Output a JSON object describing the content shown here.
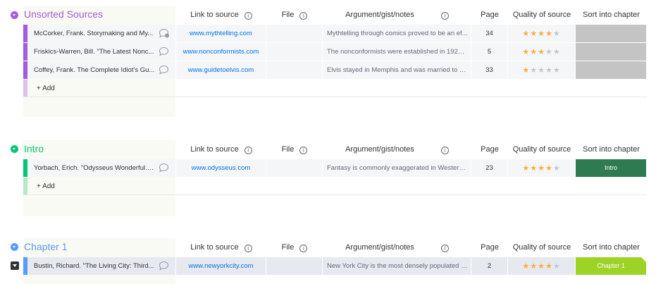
{
  "columns": {
    "link": "Link to source",
    "file": "File",
    "notes": "Argument/gist/notes",
    "page": "Page",
    "quality": "Quality of source",
    "sort": "Sort into chapter"
  },
  "colors": {
    "unsorted": "#a25ddc",
    "intro": "#00c875",
    "chapter1": "#579bfc",
    "intro_label": "#2f7b51",
    "chapter1_label": "#9cd326",
    "empty_label": "#c4c4c4",
    "star_on": "#fdab3d",
    "star_off": "#c5c7d0"
  },
  "groups": [
    {
      "title": "Unsorted Sources",
      "add_label": "+ Add",
      "rows": [
        {
          "name": "McCorker, Frank. Storymaking and My...",
          "link": "www.mythtelling.com",
          "notes": "Mythtelling through comics proved to be an ef...",
          "page": "34",
          "rating": 4,
          "chapter": ""
        },
        {
          "name": "Friskics-Warren, Bill. \"The Latest Nonc...",
          "link": "www.nonconformists.com",
          "notes": "The nonconformists were established in 1923 ...",
          "page": "5",
          "rating": 3,
          "chapter": ""
        },
        {
          "name": "Coffey, Frank. The Complete Idiot's Gu...",
          "link": "www.guidetoelvis.com",
          "notes": "Elvis stayed in Memphis and was married to P...",
          "page": "33",
          "rating": 1,
          "chapter": ""
        }
      ]
    },
    {
      "title": "Intro",
      "add_label": "+ Add",
      "rows": [
        {
          "name": "Yorbach, Erich. \"Odysseus Wonderful.\"...",
          "link": "www.odysseus.com",
          "notes": "Fantasy is commonly exaggerated in Western ...",
          "page": "23",
          "rating": 4,
          "chapter": "Intro"
        }
      ]
    },
    {
      "title": "Chapter 1",
      "rows": [
        {
          "name": "Bustin, Richard. \"The Living City: Third...",
          "link": "www.newyorkcity.com",
          "notes": "New York City is the most densely populated c...",
          "page": "2",
          "rating": 4,
          "chapter": "Chapter 1"
        }
      ]
    }
  ]
}
